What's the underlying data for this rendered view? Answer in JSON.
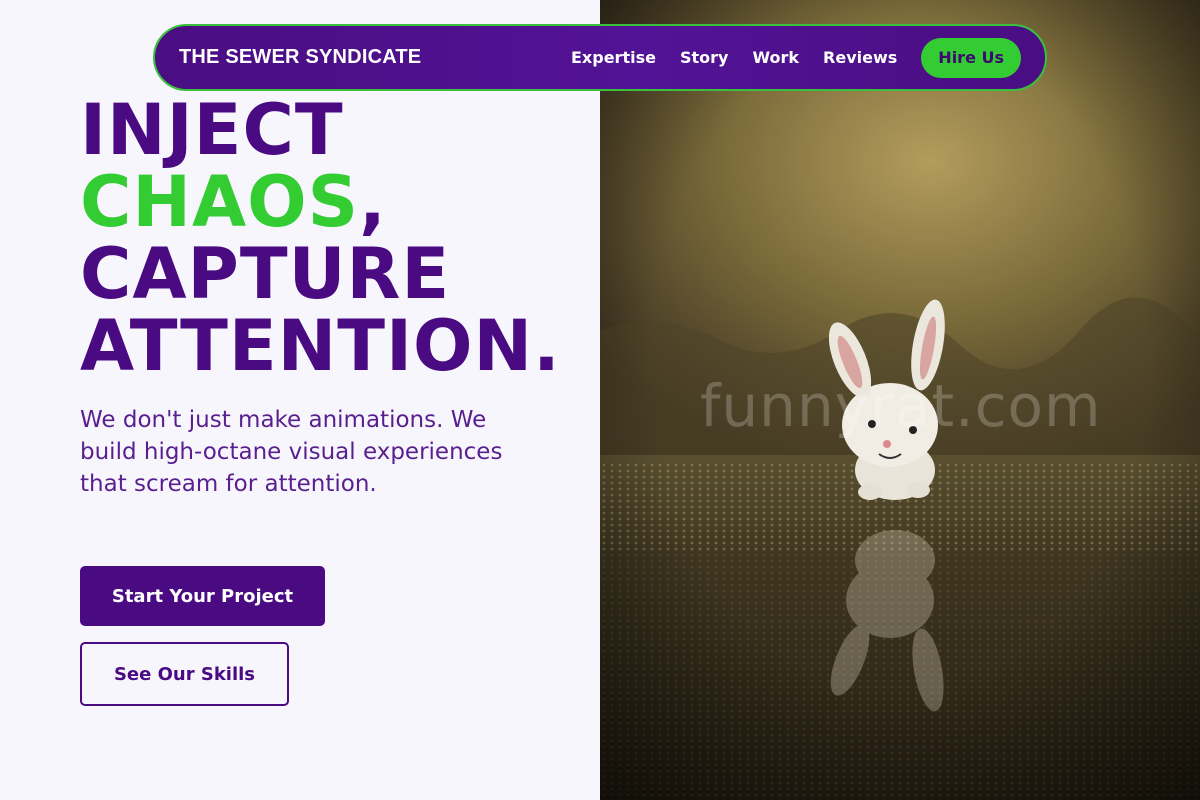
{
  "nav": {
    "brand": "THE SEWER SYNDICATE",
    "links": [
      "Expertise",
      "Story",
      "Work",
      "Reviews"
    ],
    "cta": "Hire Us"
  },
  "hero": {
    "headline_line1": "INJECT",
    "headline_accent": "CHAOS",
    "headline_comma": ",",
    "headline_line3": "CAPTURE",
    "headline_line4": "ATTENTION.",
    "tagline": "We don't just make animations. We build high-octane visual experiences that scream for attention.",
    "primary_button": "Start Your Project",
    "secondary_button": "See Our Skills"
  },
  "image": {
    "watermark": "funnyrat.com"
  },
  "colors": {
    "primary": "#4a0a82",
    "accent": "#33cc33",
    "background": "#f7f6fd"
  }
}
